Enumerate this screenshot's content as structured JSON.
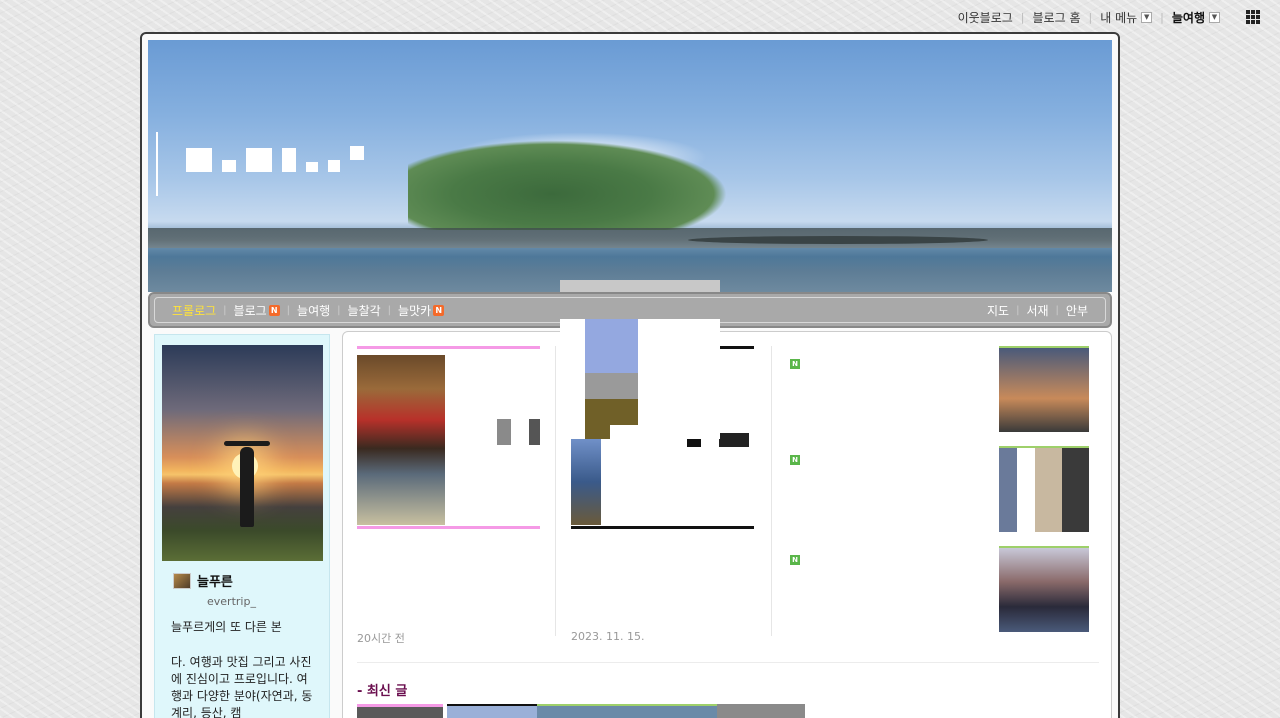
{
  "topbar": {
    "links": [
      "이웃블로그",
      "블로그 홈"
    ],
    "my_menu": "내 메뉴",
    "current_blog": "늘여행"
  },
  "nav": {
    "left": [
      {
        "label": "프롤로그",
        "active": true,
        "new": false
      },
      {
        "label": "블로그",
        "active": false,
        "new": true
      },
      {
        "label": "늘여행",
        "active": false,
        "new": false
      },
      {
        "label": "늘찰각",
        "active": false,
        "new": false
      },
      {
        "label": "늘맛카",
        "active": false,
        "new": true
      }
    ],
    "right": [
      "지도",
      "서재",
      "안부"
    ],
    "new_badge": "N"
  },
  "profile": {
    "nickname": "늘푸른",
    "user_id": "evertrip_",
    "intro_1": "늘푸르게의 또 다른 본",
    "intro_2": "다. 여행과 맛집 그리고 사진에 진심이고 프로입니다. 여행과 다양한 분야(자연과, 동계리, 등산, 캠"
  },
  "featured": [
    {
      "title": "",
      "excerpt": "",
      "date": "20시간 전"
    },
    {
      "title": "",
      "excerpt": "",
      "date": "2023. 11. 15."
    }
  ],
  "side_list": [
    {
      "title": "",
      "excerpt": "",
      "date": ""
    },
    {
      "title": "",
      "excerpt": "",
      "date": ""
    },
    {
      "title": "",
      "excerpt": "",
      "date": ""
    }
  ],
  "recent_heading": "- 최신 글",
  "colors": {
    "nav_active": "#ffe23a",
    "post_title": "#5a1a4a",
    "profile_bg": "#dff7fb",
    "new_badge": "#f46a2a"
  }
}
